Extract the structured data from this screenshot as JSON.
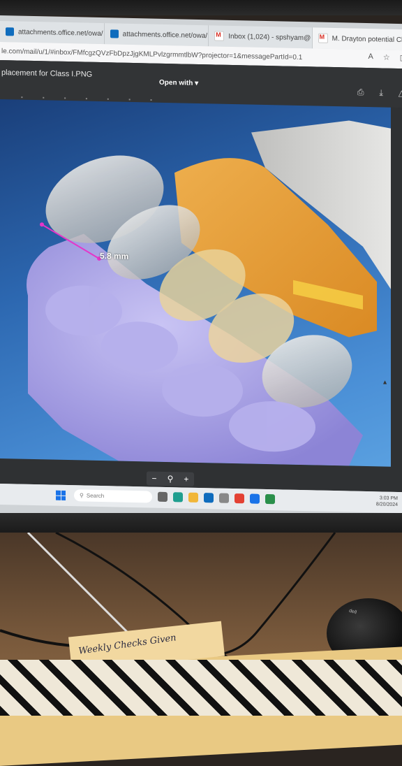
{
  "browser": {
    "tabs": [
      {
        "label": "attachments.office.net/owa/",
        "icon": "outlook-icon",
        "active": false
      },
      {
        "label": "attachments.office.net/owa/",
        "icon": "outlook-icon",
        "active": false
      },
      {
        "label": "Inbox (1,024) - spshyam@",
        "icon": "gmail-icon",
        "active": false
      },
      {
        "label": "M. Drayton potential Class I",
        "icon": "gmail-icon",
        "active": true
      }
    ],
    "address": "le.com/mail/u/1/#inbox/FMfcgzQVzFbDpzJjgKMLPvlzgrmmtlbW?projector=1&messagePartId=0.1"
  },
  "viewer": {
    "title": "placement for Class I.PNG",
    "open_with": "Open with"
  },
  "scan": {
    "measurement": "5.8 mm"
  },
  "zoom": {
    "minus": "−",
    "plus": "+"
  },
  "taskbar": {
    "search_placeholder": "Search",
    "time": "3:03 PM",
    "date": "8/20/2024"
  },
  "desk": {
    "folder_label": "Weekly Checks Given"
  },
  "colors": {
    "scan_bg": "#2c67b0",
    "gingiva": "#a9a2e8",
    "wax": "#f0a33a",
    "crown": "#d8d6d2",
    "measure": "#e535c8"
  }
}
